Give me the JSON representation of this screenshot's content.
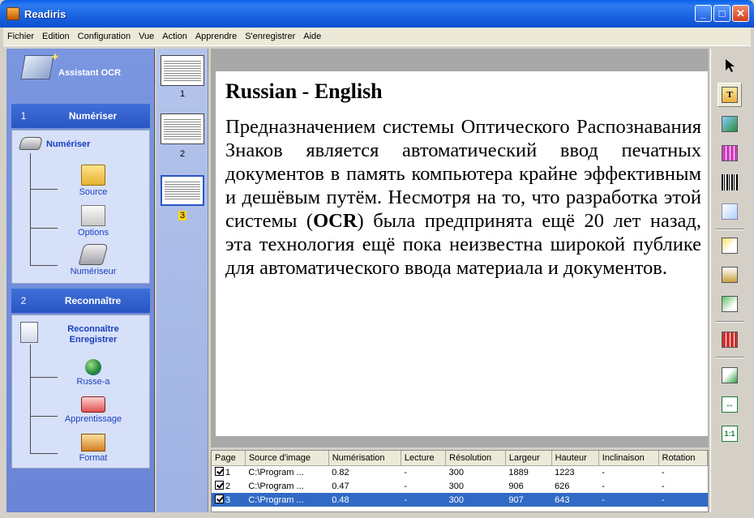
{
  "window": {
    "title": "Readiris"
  },
  "menu": [
    "Fichier",
    "Edition",
    "Configuration",
    "Vue",
    "Action",
    "Apprendre",
    "S'enregistrer",
    "Aide"
  ],
  "wizard": {
    "title": "Assistant OCR",
    "section1": {
      "number": "1",
      "label": "Numériser",
      "step": "Numériser",
      "items": [
        "Source",
        "Options",
        "Numériseur"
      ]
    },
    "section2": {
      "number": "2",
      "label": "Reconnaître",
      "step": "Reconnaître Enregistrer",
      "items": [
        "Russe-a",
        "Apprentissage",
        "Format"
      ]
    }
  },
  "thumbnails": [
    "1",
    "2",
    "3"
  ],
  "document": {
    "title": "Russian - English",
    "body_before_bold": "Предназначением системы Оптического Распознавания Знаков является автоматический ввод печатных документов в память компьютера крайне эффективным и дешёвым путём. Несмотря на то, что разработка этой системы (",
    "body_bold": "OCR",
    "body_after_bold": ") была предпринята ещё 20 лет назад, эта технология ещё пока неизвестна широкой публике для автоматического ввода материала и документов."
  },
  "table": {
    "columns": [
      "Page",
      "Source d'image",
      "Numérisation",
      "Lecture",
      "Résolution",
      "Largeur",
      "Hauteur",
      "Inclinaison",
      "Rotation"
    ],
    "rows": [
      [
        "1",
        "C:\\Program ...",
        "0.82",
        "-",
        "300",
        "1889",
        "1223",
        "-",
        "-"
      ],
      [
        "2",
        "C:\\Program ...",
        "0.47",
        "-",
        "300",
        "906",
        "626",
        "-",
        "-"
      ],
      [
        "3",
        "C:\\Program ...",
        "0.48",
        "-",
        "300",
        "907",
        "643",
        "-",
        "-"
      ]
    ],
    "selected_row": 3
  },
  "toolbar": [
    "pointer-icon",
    "text-zone-icon",
    "graphic-zone-icon",
    "table-zone-icon",
    "barcode-zone-icon",
    "handprint-zone-icon",
    "new-zone-icon",
    "insert-zone-icon",
    "order-zones-icon",
    "delete-zone-icon",
    "fit-page-icon",
    "fit-width-icon",
    "actual-size-icon"
  ],
  "colors": {
    "selection": "#316ac5",
    "accent": "#2a55c4",
    "page_highlight": "#ffd21a"
  }
}
